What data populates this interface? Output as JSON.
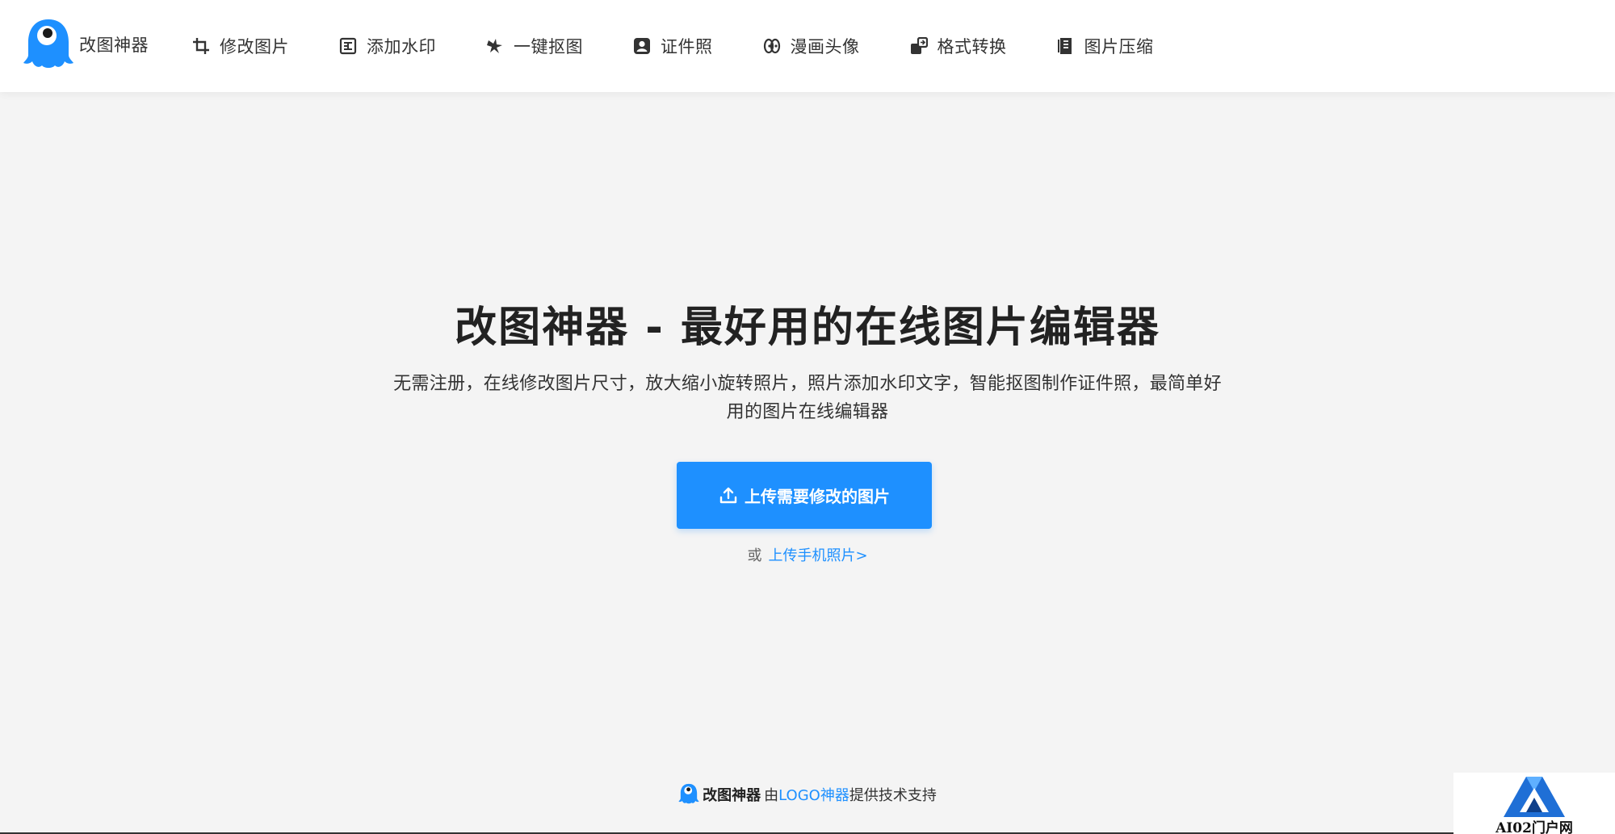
{
  "header": {
    "brand_name": "改图神器",
    "brand_color": "#1e90ff",
    "nav": [
      {
        "label": "修改图片",
        "icon": "crop-icon"
      },
      {
        "label": "添加水印",
        "icon": "watermark-icon"
      },
      {
        "label": "一键抠图",
        "icon": "magic-wand-icon"
      },
      {
        "label": "证件照",
        "icon": "id-photo-icon"
      },
      {
        "label": "漫画头像",
        "icon": "cartoon-avatar-icon"
      },
      {
        "label": "格式转换",
        "icon": "format-convert-icon"
      },
      {
        "label": "图片压缩",
        "icon": "compress-icon"
      }
    ]
  },
  "hero": {
    "title": "改图神器 - 最好用的在线图片编辑器",
    "description": "无需注册，在线修改图片尺寸，放大缩小旋转照片，照片添加水印文字，智能抠图制作证件照，最简单好用的图片在线编辑器",
    "upload_button_label": "上传需要修改的图片",
    "upload_icon": "upload-icon",
    "or_text": "或",
    "mobile_upload_link": "上传手机照片>"
  },
  "footer": {
    "brand": "改图神器",
    "by_text": "由",
    "provider_link": "LOGO神器",
    "support_text": "提供技术支持"
  },
  "watermark": {
    "text": "AI02门户网"
  },
  "colors": {
    "accent": "#1e90ff",
    "background": "#f4f4f4",
    "header_bg": "#ffffff",
    "text": "#333333"
  }
}
